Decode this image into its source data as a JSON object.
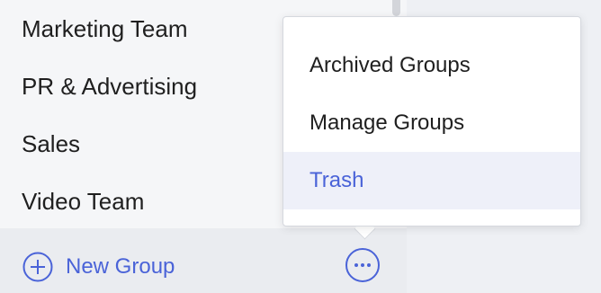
{
  "sidebar": {
    "groups": [
      {
        "label": "Marketing Team"
      },
      {
        "label": "PR & Advertising"
      },
      {
        "label": "Sales"
      },
      {
        "label": "Video Team"
      }
    ],
    "footer": {
      "new_group_label": "New Group",
      "new_group_icon": "plus-circle-icon",
      "more_icon": "more-horizontal-icon"
    }
  },
  "menu": {
    "items": [
      {
        "label": "Archived Groups"
      },
      {
        "label": "Manage Groups"
      },
      {
        "label": "Trash",
        "state": "highlighted"
      }
    ]
  },
  "colors": {
    "accent": "#4a63d8",
    "highlight_bg": "#eef0f9",
    "sidebar_bg": "#f5f6f8",
    "footer_bg": "#eaecf0"
  }
}
